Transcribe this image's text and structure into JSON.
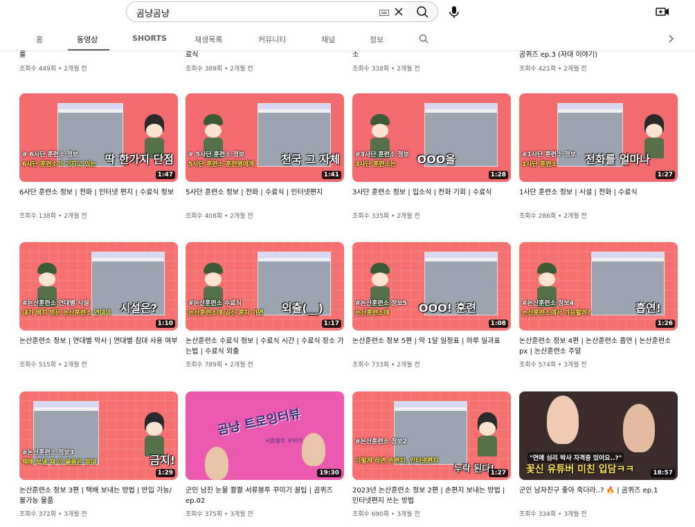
{
  "search": {
    "value": "곰냥곰냥"
  },
  "tabs": [
    {
      "label": "홈"
    },
    {
      "label": "동영상"
    },
    {
      "label": "SHORTS"
    },
    {
      "label": "재생목록"
    },
    {
      "label": "커뮤니티"
    },
    {
      "label": "채널"
    },
    {
      "label": "정보"
    }
  ],
  "partial_row": [
    {
      "title": "를",
      "meta": "조회수 449회 • 2개월 전"
    },
    {
      "title": "료식",
      "meta": "조회수 389회 • 2개월 전"
    },
    {
      "title": "소",
      "meta": "조회수 338회 • 2개월 전"
    },
    {
      "title": "곰퀴즈 ep.3 (자대 이야기)",
      "meta": "조회수 421회 • 2개월 전"
    }
  ],
  "videos": [
    {
      "title": "6사단 훈련소 정보 | 전화 | 인터넷 편지 | 수료식 정보",
      "meta": "조회수 138회 • 2개월 전",
      "duration": "1:47",
      "tag": "# 6사단 훈련소 정보",
      "caption": "6사단 훈련소가 기지고 있는",
      "headline": "딱 한가지 단점"
    },
    {
      "title": "5사단 훈련소 정보 | 전화 | 수료식 | 인터넷편지",
      "meta": "조회수 408회 • 2개월 전",
      "duration": "1:41",
      "tag": "# 5사단 훈련소 정보",
      "caption": "5사단 훈련소 훈련병에게",
      "headline": "천국 그 자체"
    },
    {
      "title": "3사단 훈련소 정보 | 입소식 | 전화 기회 | 수료식",
      "meta": "조회수 335회 • 2개월 전",
      "duration": "1:28",
      "tag": "#3사단 훈련소 정보",
      "caption": "3사단 훈련소는",
      "headline": "OOO을"
    },
    {
      "title": "1사단 훈련소 정보 | 시설 | 전화 | 수료식",
      "meta": "조회수 286회 • 2개월 전",
      "duration": "1:27",
      "tag": "#1사단 훈련소 정보",
      "caption": "1사단 훈련소",
      "headline": "전화를 얼마나"
    },
    {
      "title": "논산훈련소 정보 | 연대별 막사 | 연대별 침대 사용 여부",
      "meta": "조회수 515회 • 2개월 전",
      "duration": "1:10",
      "tag": "#논산훈련소 연대별 시설",
      "caption": "내가 배치 받은 논산훈련소 연대의",
      "headline": "시설은?"
    },
    {
      "title": "논산훈련소 수료식 정보 | 수료식 시간 | 수료식 장소 가는법 | 수료식 외출",
      "meta": "조회수 789회 • 2개월 전",
      "duration": "1:17",
      "tag": "#논산훈련소 수료식",
      "caption": "논산훈련소에 곰신 혼자 가면",
      "headline": "외출(__)"
    },
    {
      "title": "논산훈련소 정보 5편 | 악 1달 일정표 | 하루 일과표",
      "meta": "조회수 733회 • 2개월 전",
      "duration": "1:08",
      "tag": "#논산훈련소 정보5",
      "caption": "논산훈련소에",
      "headline": "OOO! 훈련"
    },
    {
      "title": "논산훈련소 정보 4편 | 논산훈련소 흡연 | 논산훈련소 px | 논산훈련소 주말",
      "meta": "조회수 574회 • 3개월 전",
      "duration": "1:26",
      "tag": "#논산훈련소 정보4",
      "caption": "논산훈련소에서 가능할까?",
      "headline": "흡연!"
    },
    {
      "title": "논산훈련소 정보 3편 | 택배 보내는 방법 | 반입 가능/불가능 물품",
      "meta": "조회수 372회 • 3개월 전",
      "duration": "1:29",
      "tag": "#논산훈련소 정보3",
      "caption": "택배 보낼 때 이 물품은 절대",
      "headline": "금지!"
    },
    {
      "title": "군인 남친 눈물 콸콸 서류봉투 꾸미기 꿀팁 | 곰퀴즈 ep.02",
      "meta": "조회수 375회 • 3개월 전",
      "duration": "19:30",
      "tag": "",
      "caption": "서류봉투 꾸미기",
      "headline": "곰냥 트로잉터뷰"
    },
    {
      "title": "2023년 논산훈련소 정보 2편 | 손편지 보내는 방법 | 인터넷편지 쓰는 방법",
      "meta": "조회수 690회 • 3개월 전",
      "duration": "1:27",
      "tag": "#논산훈련소 정보2",
      "caption": "이렇게 하면 손편지, 인터넷편지",
      "headline": "누락 된다!"
    },
    {
      "title": "군인 남자친구 좋아 죽더라..? 🔥 | 곰퀴즈 ep.1",
      "meta": "조회수 334회 • 3개월 전",
      "duration": "18:57",
      "tag": "",
      "caption": "\"연애 심리 박사 자격증 있어요..?\"",
      "headline": "꽃신 유튜버 미친 입담ㅋㅋ"
    }
  ],
  "colors": {
    "accent_pink": "#f36a6f",
    "text_secondary": "#606060"
  }
}
